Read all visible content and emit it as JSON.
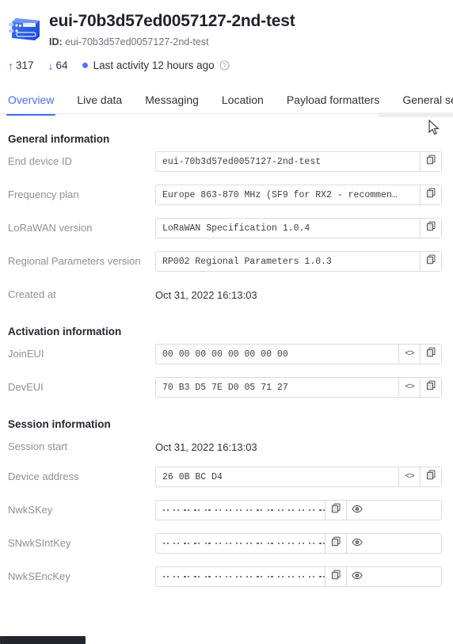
{
  "header": {
    "icon": "end-device-icon",
    "title": "eui-70b3d57ed0057127-2nd-test",
    "id_label": "ID:",
    "id_value": "eui-70b3d57ed0057127-2nd-test"
  },
  "stats": {
    "uplink_arrow": "↑",
    "uplink_count": "317",
    "downlink_arrow": "↓",
    "downlink_count": "64",
    "activity_text": "Last activity 12 hours ago",
    "help_icon": "question-circle-icon",
    "accent_color": "#4a6cf7",
    "status_dot_color": "#4f76ec"
  },
  "tabs": [
    {
      "label": "Overview",
      "active": true
    },
    {
      "label": "Live data",
      "active": false
    },
    {
      "label": "Messaging",
      "active": false
    },
    {
      "label": "Location",
      "active": false
    },
    {
      "label": "Payload formatters",
      "active": false
    },
    {
      "label": "General settings",
      "active": false
    }
  ],
  "sections": [
    {
      "title": "General information",
      "rows": [
        {
          "label": "End device ID",
          "value": "eui-70b3d57ed0057127-2nd-test",
          "type": "field",
          "buttons": [
            "copy-icon"
          ]
        },
        {
          "label": "Frequency plan",
          "value": "Europe 863-870 MHz (SF9 for RX2 - recommen…",
          "type": "field",
          "buttons": [
            "copy-icon"
          ]
        },
        {
          "label": "LoRaWAN version",
          "value": "LoRaWAN Specification 1.0.4",
          "type": "field",
          "buttons": [
            "copy-icon"
          ]
        },
        {
          "label": "Regional Parameters version",
          "value": "RP002 Regional Parameters 1.0.3",
          "type": "field",
          "buttons": [
            "copy-icon"
          ]
        },
        {
          "label": "Created at",
          "value": "Oct 31, 2022 16:13:03",
          "type": "plain",
          "buttons": []
        }
      ]
    },
    {
      "title": "Activation information",
      "rows": [
        {
          "label": "JoinEUI",
          "value": "00 00 00 00 00 00 00 00",
          "type": "field",
          "buttons": [
            "code-icon",
            "copy-icon"
          ]
        },
        {
          "label": "DevEUI",
          "value": "70 B3 D5 7E D0 05 71 27",
          "type": "field",
          "buttons": [
            "code-icon",
            "copy-icon"
          ]
        }
      ]
    },
    {
      "title": "Session information",
      "rows": [
        {
          "label": "Session start",
          "value": "Oct 31, 2022 16:13:03",
          "type": "plain",
          "buttons": []
        },
        {
          "label": "Device address",
          "value": "26 0B BC D4",
          "type": "field",
          "buttons": [
            "code-icon",
            "copy-icon"
          ]
        },
        {
          "label": "NwkSKey",
          "value": "",
          "type": "masked",
          "masked_pairs": 16,
          "buttons": [
            "copy-icon",
            "eye-icon"
          ]
        },
        {
          "label": "SNwkSIntKey",
          "value": "",
          "type": "masked",
          "masked_pairs": 16,
          "buttons": [
            "copy-icon",
            "eye-icon"
          ]
        },
        {
          "label": "NwkSEncKey",
          "value": "",
          "type": "masked",
          "masked_pairs": 16,
          "buttons": [
            "copy-icon",
            "eye-icon"
          ]
        }
      ]
    }
  ]
}
